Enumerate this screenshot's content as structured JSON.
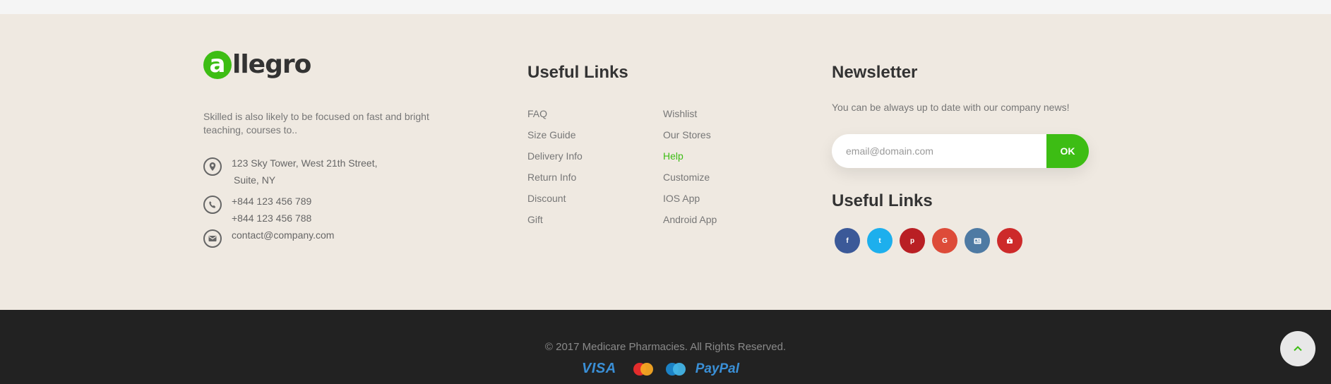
{
  "brand": {
    "logo_letter": "a",
    "logo_rest": "llegro",
    "about": "Skilled is also likely to be focused on fast and bright teaching, courses to..",
    "address_line1": "123 Sky Tower, West 21th Street,",
    "address_line2": "Suite, NY",
    "phone1": "+844 123 456 789",
    "phone2": "+844 123 456 788",
    "email": "contact@company.com"
  },
  "useful_links": {
    "title": "Useful Links",
    "col1": [
      "FAQ",
      "Size Guide",
      "Delivery Info",
      "Return Info",
      "Discount",
      "Gift"
    ],
    "col2": [
      "Wishlist",
      "Our Stores",
      "Help",
      "Customize",
      "IOS App",
      "Android App"
    ]
  },
  "newsletter": {
    "title": "Newsletter",
    "text": "You can be always up to date with our company news!",
    "placeholder": "email@domain.com",
    "button": "OK"
  },
  "social": {
    "title": "Useful Links",
    "items": [
      {
        "glyph": "f",
        "icon": "facebook-icon",
        "color": "#3b5998"
      },
      {
        "glyph": "t",
        "icon": "twitter-icon",
        "color": "#1dafed"
      },
      {
        "glyph": "p",
        "icon": "pinterest-icon",
        "color": "#b91f24"
      },
      {
        "glyph": "G",
        "icon": "google-plus-icon",
        "color": "#dd4b39"
      },
      {
        "glyph": "",
        "icon": "vk-icon",
        "color": "#4e7aa3"
      },
      {
        "glyph": "",
        "icon": "youtube-icon",
        "color": "#cd2a2a"
      }
    ]
  },
  "footer": {
    "copyright": "© 2017 Medicare Pharmacies. All Rights Reserved.",
    "payments": {
      "visa": "VISA",
      "mastercard": "MasterCard",
      "cirrus": "Cirrus",
      "paypal": "PayPal"
    }
  },
  "colors": {
    "accent": "#3dbd14",
    "footer_bg": "#efe9e1",
    "bottom_bg": "#222222"
  }
}
